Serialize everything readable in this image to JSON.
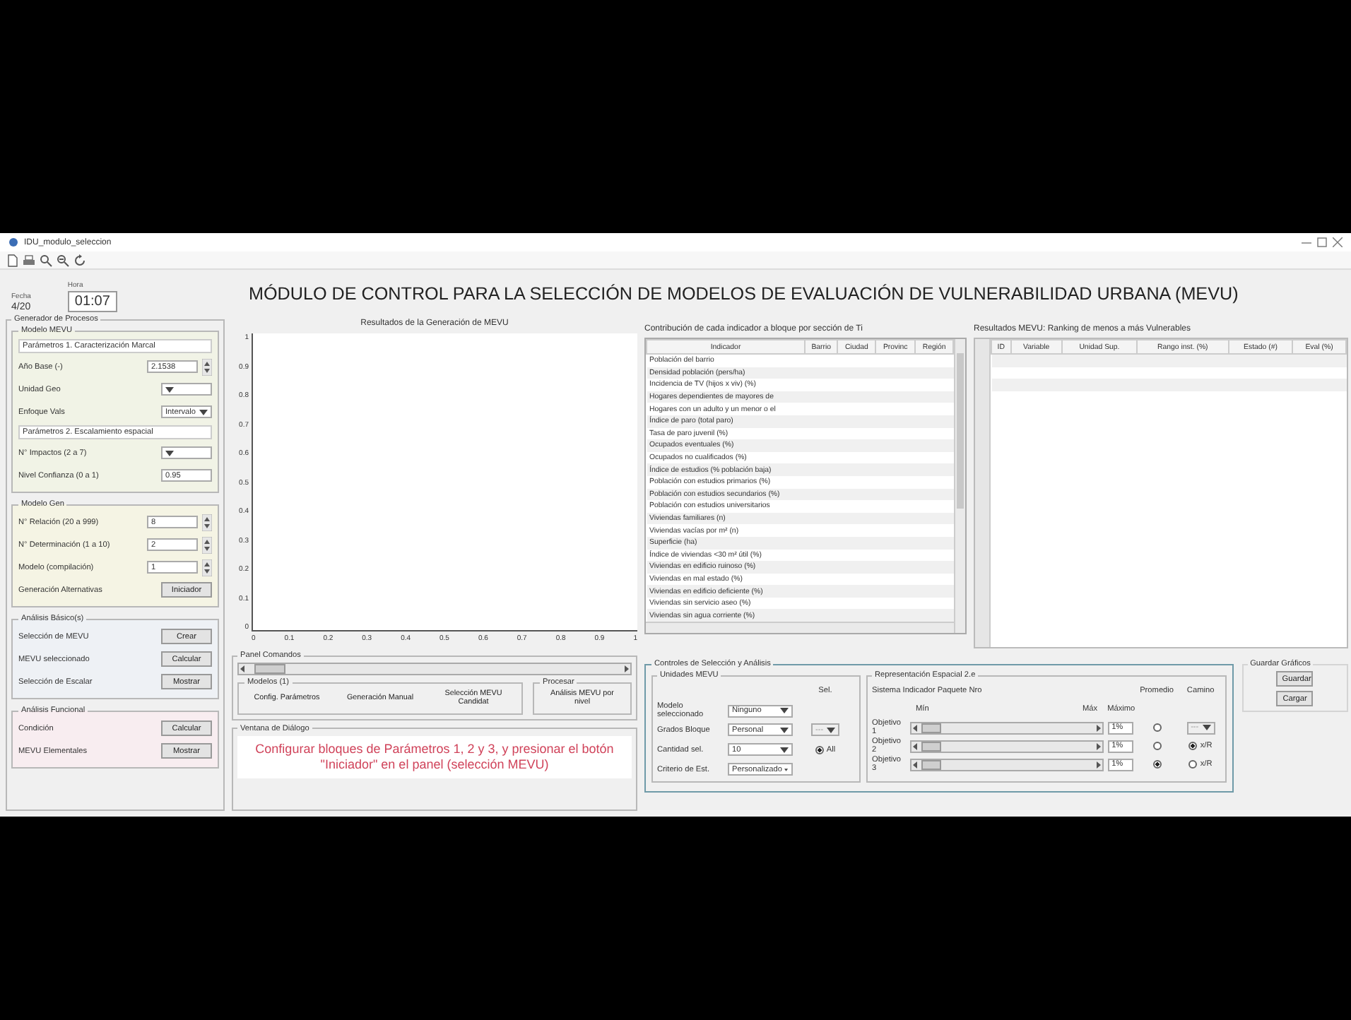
{
  "window": {
    "title": "IDU_modulo_seleccion"
  },
  "header": {
    "date_label": "Fecha",
    "date": "4/20",
    "time_label": "Hora",
    "time": "01:07"
  },
  "title": "MÓDULO DE CONTROL PARA LA SELECCIÓN DE MODELOS DE EVALUACIÓN DE VULNERABILIDAD URBANA (MEVU)",
  "generator": {
    "title": "Generador de Procesos",
    "sections": [
      {
        "title": "Modelo MEVU",
        "color": "#f1f3e6",
        "rows": [
          {
            "kind": "heading",
            "label": "Parámetros 1. Caracterización Marcal"
          },
          {
            "kind": "spin",
            "label": "Año Base (-)",
            "value": "2.1538"
          },
          {
            "kind": "dropdown",
            "label": "Unidad Geo"
          },
          {
            "kind": "dropdown",
            "label": "Enfoque Vals",
            "value": "Intervalo"
          },
          {
            "kind": "heading",
            "label": "Parámetros 2. Escalamiento espacial"
          },
          {
            "kind": "dropdown",
            "label": "N° Impactos (2 a 7)"
          },
          {
            "kind": "input",
            "label": "Nivel Confianza (0 a 1)",
            "value": "0.95"
          }
        ]
      },
      {
        "title": "Modelo Gen",
        "color": "#f5f4e4",
        "rows": [
          {
            "kind": "spin",
            "label": "N° Relación (20 a 999)",
            "value": "8"
          },
          {
            "kind": "spin",
            "label": "N° Determinación (1 a 10)",
            "value": "2"
          },
          {
            "kind": "spin",
            "label": "Modelo (compilación)",
            "value": "1"
          },
          {
            "kind": "button",
            "label": "Generación Alternativas",
            "button": "Iniciador"
          }
        ]
      },
      {
        "title": "Análisis Básico(s)",
        "color": "#eef1f5",
        "rows": [
          {
            "kind": "button",
            "label": "Selección de MEVU",
            "button": "Crear"
          },
          {
            "kind": "button",
            "label": "MEVU seleccionado",
            "button": "Calcular"
          },
          {
            "kind": "button",
            "label": "Selección de Escalar",
            "button": "Mostrar"
          }
        ]
      },
      {
        "title": "Análisis Funcional",
        "color": "#f8edf0",
        "rows": [
          {
            "kind": "button",
            "label": "Condición",
            "button": "Calcular"
          },
          {
            "kind": "button",
            "label": "MEVU Elementales",
            "button": "Mostrar"
          }
        ]
      }
    ]
  },
  "plot": {
    "title": "Resultados de la Generación de MEVU",
    "y_ticks": [
      "1",
      "0.9",
      "0.8",
      "0.7",
      "0.6",
      "0.5",
      "0.4",
      "0.3",
      "0.2",
      "0.1",
      "0"
    ],
    "x_ticks": [
      "0",
      "0.1",
      "0.2",
      "0.3",
      "0.4",
      "0.5",
      "0.6",
      "0.7",
      "0.8",
      "0.9",
      "1"
    ]
  },
  "indicators": {
    "caption": "Contribución de cada indicador a bloque por sección de Ti",
    "columns": [
      "Indicador",
      "Barrio",
      "Ciudad",
      "Provinc",
      "Región"
    ],
    "rows": [
      "Población del barrio",
      "Densidad población (pers/ha)",
      "Incidencia de TV (hijos x viv) (%)",
      "Hogares dependientes de mayores de",
      "Hogares con un adulto y un menor o el",
      "Índice de paro (total paro)",
      "Tasa de paro juvenil (%)",
      "Ocupados eventuales (%)",
      "Ocupados no cualificados (%)",
      "Índice de estudios (% población baja)",
      "Población con estudios primarios (%)",
      "Población con estudios secundarios (%)",
      "Población con estudios universitarios",
      "Viviendas familiares (n)",
      "Viviendas vacías por m² (n)",
      "Superficie (ha)",
      "Índice de viviendas <30 m² útil (%)",
      "Viviendas en edificio ruinoso (%)",
      "Viviendas en mal estado (%)",
      "Viviendas en edificio deficiente (%)",
      "Viviendas sin servicio aseo (%)",
      "Viviendas sin agua corriente (%)"
    ]
  },
  "results": {
    "caption": "Resultados MEVU: Ranking de menos a más Vulnerables",
    "columns": [
      "ID",
      "Variable",
      "Unidad Sup.",
      "Rango inst. (%)",
      "Estado (#)",
      "Eval (%)"
    ]
  },
  "commands": {
    "title": "Panel Comandos",
    "slider": {
      "level": 0.04
    },
    "groups": [
      {
        "title": "Modelos (1)",
        "buttons": [
          "Config. Parámetros",
          "Generación Manual",
          "Selección MEVU Candidat"
        ]
      },
      {
        "title": "Procesar",
        "buttons": [
          "Análisis MEVU por nivel"
        ]
      }
    ]
  },
  "dialog": {
    "title": "Ventana de Diálogo",
    "message": "Configurar bloques de Parámetros 1, 2 y 3, y presionar el botón \"Iniciador\" en el panel (selección MEVU)"
  },
  "controls": {
    "title": "Controles de Selección y Análisis",
    "units": {
      "title": "Unidades MEVU",
      "sel_header": "Sel.",
      "rows": [
        {
          "label": "Modelo seleccionado",
          "value": "Ninguno"
        },
        {
          "label": "Grados Bloque",
          "value": "Personal",
          "sel": {
            "kind": "dropdown",
            "value": "---",
            "disabled": true
          }
        },
        {
          "label": "Cantidad sel.",
          "value": "10",
          "sel": {
            "kind": "radio",
            "label": "All",
            "selected": true
          }
        },
        {
          "label": "Criterio de Est.",
          "value": "Personalizado"
        }
      ]
    },
    "spatial": {
      "title": "Representación Espacial 2.e",
      "subtitle": "Sistema Indicador Paquete Nro",
      "min_label": "Mín",
      "max_label": "Máx",
      "value_header": "Máximo",
      "average_header": "Promedio",
      "path_header": "Camino",
      "rows": [
        {
          "label": "Objetivo 1",
          "level": 0.05,
          "value": "1%",
          "average_selected": false,
          "path": {
            "kind": "dropdown",
            "value": "---",
            "disabled": true
          }
        },
        {
          "label": "Objetivo 2",
          "level": 0.05,
          "value": "1%",
          "average_selected": false,
          "path": {
            "kind": "radio",
            "label": "x/R",
            "selected": true
          }
        },
        {
          "label": "Objetivo 3",
          "level": 0.05,
          "value": "1%",
          "average_selected": true,
          "path": {
            "kind": "radio",
            "label": "x/R",
            "selected": false
          }
        }
      ]
    }
  },
  "save": {
    "title": "Guardar Gráficos",
    "buttons": [
      "Guardar",
      "Cargar"
    ]
  }
}
